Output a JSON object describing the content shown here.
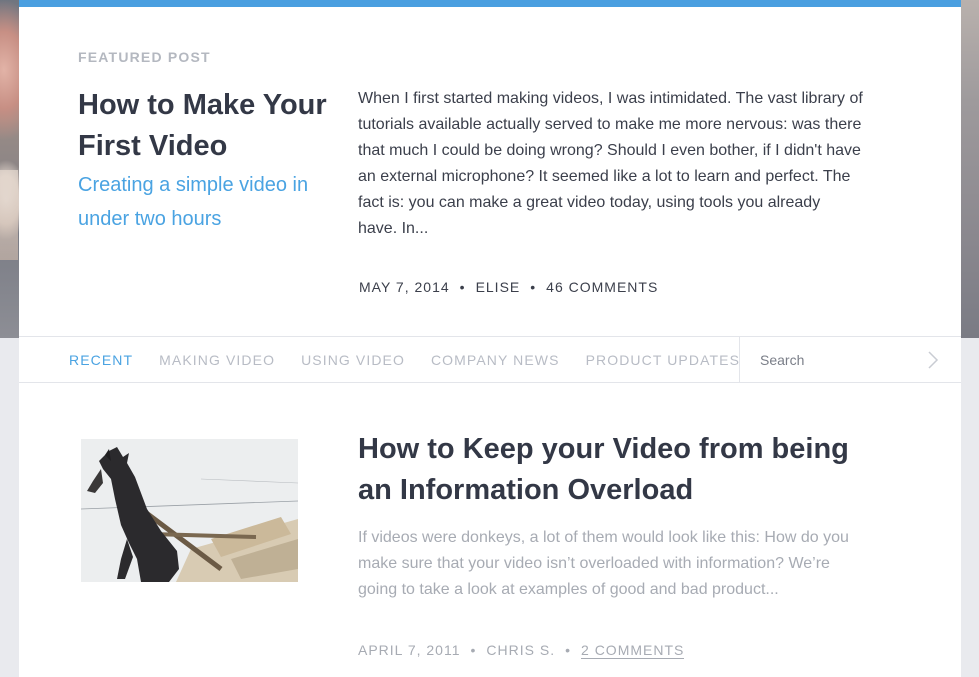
{
  "featured": {
    "label": "FEATURED POST",
    "title": "How to Make Your First Video",
    "subtitle": "Creating a simple video in under two hours",
    "excerpt": "When I first started making videos, I was intimidated. The vast library of tutorials available actually served to make me more nervous: was there that much I could be doing wrong? Should I even bother, if I didn't have an external microphone? It seemed like a lot to learn and perfect. The fact is: you can make a great video today, using tools you already have. In...",
    "date": "MAY 7, 2014",
    "author": "ELISE",
    "comments": "46 COMMENTS",
    "separator": "•",
    "accent_color": "#4aa3e2"
  },
  "nav": {
    "tabs": [
      {
        "label": "RECENT",
        "active": true
      },
      {
        "label": "MAKING VIDEO",
        "active": false
      },
      {
        "label": "USING VIDEO",
        "active": false
      },
      {
        "label": "COMPANY NEWS",
        "active": false
      },
      {
        "label": "PRODUCT UPDATES",
        "active": false
      }
    ],
    "search_placeholder": "Search",
    "search_icon": "chevron-right-icon"
  },
  "post": {
    "title": "How to Keep your Video from being an Information Overload",
    "excerpt": "If videos were donkeys, a lot of them would look like this: How do you make sure that your video isn’t overloaded with information? We’re going to take a look at examples of good and bad product...",
    "date": "APRIL 7, 2011",
    "author": "CHRIS S.",
    "comments": "2 COMMENTS",
    "separator": "•",
    "thumbnail": "overloaded-donkey-photo"
  }
}
